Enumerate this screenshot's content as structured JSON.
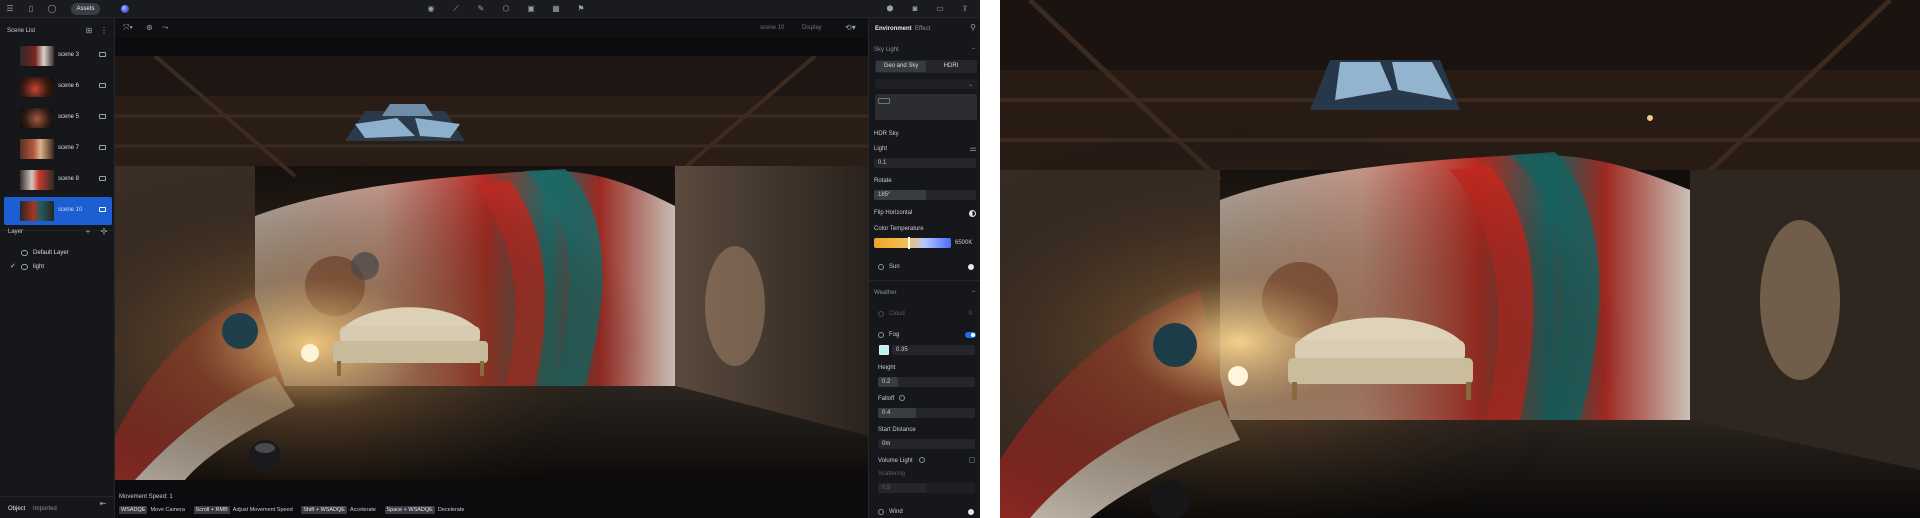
{
  "topbar": {
    "assets_label": "Assets",
    "left_icons": [
      "menu-icon",
      "file-icon",
      "chat-icon"
    ],
    "center_icons": [
      "light-icon",
      "tool-icon",
      "draw-icon",
      "shape-icon",
      "box-icon",
      "grid-icon",
      "flag-icon"
    ],
    "right_icons": [
      "cube-icon",
      "camera-icon",
      "video-icon",
      "export-icon"
    ]
  },
  "scene_list": {
    "title": "Scene List",
    "items": [
      {
        "label": "scene 3",
        "selected": false
      },
      {
        "label": "scene 6",
        "selected": false
      },
      {
        "label": "scene 5",
        "selected": false
      },
      {
        "label": "scene 7",
        "selected": false
      },
      {
        "label": "scene 8",
        "selected": false
      },
      {
        "label": "scene 10",
        "selected": true
      }
    ]
  },
  "layer": {
    "title": "Layer",
    "items": [
      {
        "label": "Default Layer",
        "checked": false
      },
      {
        "label": "light",
        "checked": true
      }
    ]
  },
  "left_tabs": {
    "object": "Object",
    "imported": "Imported"
  },
  "viewport": {
    "right_label_1": "scene 10",
    "right_label_2": "Display",
    "movement_speed": "Movement Speed: 1",
    "hints": [
      {
        "keys": "WSADQE",
        "desc": "Move Camera"
      },
      {
        "keys": "Scroll + RMB",
        "desc": "Adjust Movement Speed"
      },
      {
        "keys": "Shift + WSADQE",
        "desc": "Accelerate"
      },
      {
        "keys": "Space + WSADQE",
        "desc": "Decelerate"
      }
    ]
  },
  "right_panel": {
    "tab_environment": "Environment",
    "tab_effect": "Effect",
    "sky_light": "Sky Light",
    "geo_and_sky": "Geo and Sky",
    "hdri": "HDRI",
    "hdr_sky": "HDR Sky",
    "light_label": "Light",
    "light_value": "0.1",
    "rotate_label": "Rotate",
    "rotate_value": "185°",
    "flip_horizontal": "Flip Horizontal",
    "color_temperature": "Color Temperature",
    "color_temp_value": "6500K",
    "sun": "Sun",
    "weather": "Weather",
    "cloud": "Cloud",
    "cloud_value": "0",
    "fog": "Fog",
    "fog_value": "0.35",
    "height_label": "Height",
    "height_value": "0.2",
    "falloff_label": "Falloff",
    "falloff_value": "0.4",
    "start_distance_label": "Start Distance",
    "start_distance_value": "0m",
    "volume_light": "Volume Light",
    "scattering": "Scattering",
    "scattering_value": "0.5",
    "wind": "Wind"
  },
  "colors": {
    "accent": "#1c5fd3",
    "panel_bg": "#16171b",
    "fog_swatch": "#bff3f3"
  }
}
